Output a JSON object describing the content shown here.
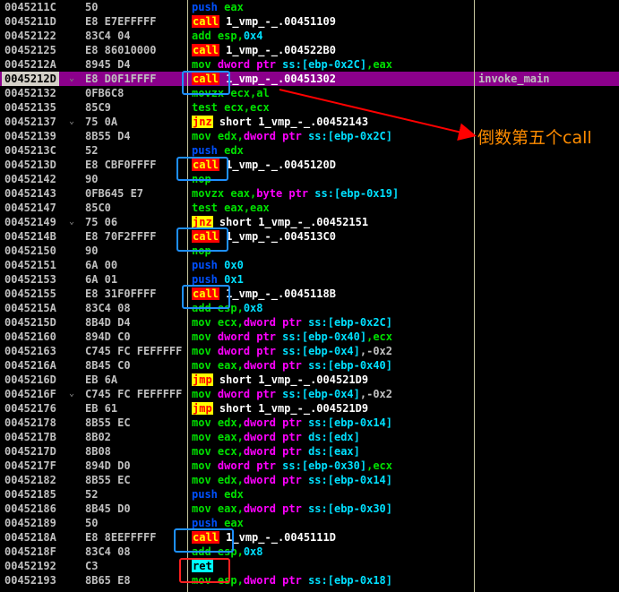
{
  "rows": [
    {
      "addr": "0045211C",
      "bytes": "50",
      "mn": "push",
      "mc": "m-push",
      "ops": [
        {
          "t": "eax",
          "c": "o-reg"
        }
      ]
    },
    {
      "addr": "0045211D",
      "bytes": "E8 E7EFFFFF",
      "mn": "call",
      "mc": "m-call",
      "ops": [
        {
          "t": "1_vmp_-_.00451109",
          "c": "o-default"
        }
      ]
    },
    {
      "addr": "00452122",
      "bytes": "83C4 04",
      "mn": "add",
      "mc": "m-add",
      "ops": [
        {
          "t": "esp,",
          "c": "o-reg"
        },
        {
          "t": "0x4",
          "c": "o-imm"
        }
      ]
    },
    {
      "addr": "00452125",
      "bytes": "E8 86010000",
      "mn": "call",
      "mc": "m-call",
      "ops": [
        {
          "t": "1_vmp_-_.004522B0",
          "c": "o-default"
        }
      ]
    },
    {
      "addr": "0045212A",
      "bytes": "8945 D4",
      "mn": "mov",
      "mc": "m-mov",
      "ops": [
        {
          "t": "dword ptr ss:[ebp-0x2C]",
          "c": "o-mem"
        },
        {
          "t": ",eax",
          "c": "o-reg"
        }
      ]
    },
    {
      "addr": "0045212D",
      "bytes": "E8 D0F1FFFF",
      "mn": "call",
      "mc": "m-call",
      "ops": [
        {
          "t": "1_vmp_-_.00451302",
          "c": "o-default"
        }
      ],
      "comment": "invoke_main",
      "selected": true,
      "bp": true
    },
    {
      "addr": "00452132",
      "bytes": "0FB6C8",
      "mn": "movzx",
      "mc": "m-movzx",
      "ops": [
        {
          "t": "ecx,al",
          "c": "o-reg"
        }
      ]
    },
    {
      "addr": "00452135",
      "bytes": "85C9",
      "mn": "test",
      "mc": "m-test",
      "ops": [
        {
          "t": "ecx,ecx",
          "c": "o-reg"
        }
      ]
    },
    {
      "addr": "00452137",
      "bytes": "75 0A",
      "mn": "jnz",
      "mc": "m-jcc",
      "ops": [
        {
          "t": "short 1_vmp_-_.00452143",
          "c": "o-default"
        }
      ],
      "bp": true
    },
    {
      "addr": "00452139",
      "bytes": "8B55 D4",
      "mn": "mov",
      "mc": "m-mov",
      "ops": [
        {
          "t": "edx,",
          "c": "o-reg"
        },
        {
          "t": "dword ptr ss:[ebp-0x2C]",
          "c": "o-mem"
        }
      ]
    },
    {
      "addr": "0045213C",
      "bytes": "52",
      "mn": "push",
      "mc": "m-push",
      "ops": [
        {
          "t": "edx",
          "c": "o-reg"
        }
      ]
    },
    {
      "addr": "0045213D",
      "bytes": "E8 CBF0FFFF",
      "mn": "call",
      "mc": "m-call",
      "ops": [
        {
          "t": "1_vmp_-_.0045120D",
          "c": "o-default"
        }
      ]
    },
    {
      "addr": "00452142",
      "bytes": "90",
      "mn": "nop",
      "mc": "m-nop",
      "ops": []
    },
    {
      "addr": "00452143",
      "bytes": "0FB645 E7",
      "mn": "movzx",
      "mc": "m-movzx",
      "ops": [
        {
          "t": "eax,",
          "c": "o-reg"
        },
        {
          "t": "byte ptr ss:[ebp-0x19]",
          "c": "o-mem"
        }
      ]
    },
    {
      "addr": "00452147",
      "bytes": "85C0",
      "mn": "test",
      "mc": "m-test",
      "ops": [
        {
          "t": "eax,eax",
          "c": "o-reg"
        }
      ]
    },
    {
      "addr": "00452149",
      "bytes": "75 06",
      "mn": "jnz",
      "mc": "m-jcc",
      "ops": [
        {
          "t": "short 1_vmp_-_.00452151",
          "c": "o-default"
        }
      ],
      "bp": true
    },
    {
      "addr": "0045214B",
      "bytes": "E8 70F2FFFF",
      "mn": "call",
      "mc": "m-call",
      "ops": [
        {
          "t": "1_vmp_-_.004513C0",
          "c": "o-default"
        }
      ]
    },
    {
      "addr": "00452150",
      "bytes": "90",
      "mn": "nop",
      "mc": "m-nop",
      "ops": []
    },
    {
      "addr": "00452151",
      "bytes": "6A 00",
      "mn": "push",
      "mc": "m-push",
      "ops": [
        {
          "t": "0x0",
          "c": "o-imm"
        }
      ]
    },
    {
      "addr": "00452153",
      "bytes": "6A 01",
      "mn": "push",
      "mc": "m-push",
      "ops": [
        {
          "t": "0x1",
          "c": "o-imm"
        }
      ]
    },
    {
      "addr": "00452155",
      "bytes": "E8 31F0FFFF",
      "mn": "call",
      "mc": "m-call",
      "ops": [
        {
          "t": "1_vmp_-_.0045118B",
          "c": "o-default"
        }
      ]
    },
    {
      "addr": "0045215A",
      "bytes": "83C4 08",
      "mn": "add",
      "mc": "m-add",
      "ops": [
        {
          "t": "esp,",
          "c": "o-reg"
        },
        {
          "t": "0x8",
          "c": "o-imm"
        }
      ]
    },
    {
      "addr": "0045215D",
      "bytes": "8B4D D4",
      "mn": "mov",
      "mc": "m-mov",
      "ops": [
        {
          "t": "ecx,",
          "c": "o-reg"
        },
        {
          "t": "dword ptr ss:[ebp-0x2C]",
          "c": "o-mem"
        }
      ]
    },
    {
      "addr": "00452160",
      "bytes": "894D C0",
      "mn": "mov",
      "mc": "m-mov",
      "ops": [
        {
          "t": "dword ptr ss:[ebp-0x40]",
          "c": "o-mem"
        },
        {
          "t": ",ecx",
          "c": "o-reg"
        }
      ]
    },
    {
      "addr": "00452163",
      "bytes": "C745 FC FEFFFFF",
      "mn": "mov",
      "mc": "m-mov",
      "ops": [
        {
          "t": "dword ptr ss:[ebp-0x4]",
          "c": "o-mem"
        },
        {
          "t": ",-0x2",
          "c": "neg"
        }
      ]
    },
    {
      "addr": "0045216A",
      "bytes": "8B45 C0",
      "mn": "mov",
      "mc": "m-mov",
      "ops": [
        {
          "t": "eax,",
          "c": "o-reg"
        },
        {
          "t": "dword ptr ss:[ebp-0x40]",
          "c": "o-mem"
        }
      ]
    },
    {
      "addr": "0045216D",
      "bytes": "EB 6A",
      "mn": "jmp",
      "mc": "m-jmp",
      "ops": [
        {
          "t": "short 1_vmp_-_.004521D9",
          "c": "o-default"
        }
      ]
    },
    {
      "addr": "0045216F",
      "bytes": "C745 FC FEFFFFF",
      "mn": "mov",
      "mc": "m-mov",
      "ops": [
        {
          "t": "dword ptr ss:[ebp-0x4]",
          "c": "o-mem"
        },
        {
          "t": ",-0x2",
          "c": "neg"
        }
      ],
      "bp": true
    },
    {
      "addr": "00452176",
      "bytes": "EB 61",
      "mn": "jmp",
      "mc": "m-jmp",
      "ops": [
        {
          "t": "short 1_vmp_-_.004521D9",
          "c": "o-default"
        }
      ]
    },
    {
      "addr": "00452178",
      "bytes": "8B55 EC",
      "mn": "mov",
      "mc": "m-mov",
      "ops": [
        {
          "t": "edx,",
          "c": "o-reg"
        },
        {
          "t": "dword ptr ss:[ebp-0x14]",
          "c": "o-mem"
        }
      ]
    },
    {
      "addr": "0045217B",
      "bytes": "8B02",
      "mn": "mov",
      "mc": "m-mov",
      "ops": [
        {
          "t": "eax,",
          "c": "o-reg"
        },
        {
          "t": "dword ptr ds:[edx]",
          "c": "o-memds"
        }
      ]
    },
    {
      "addr": "0045217D",
      "bytes": "8B08",
      "mn": "mov",
      "mc": "m-mov",
      "ops": [
        {
          "t": "ecx,",
          "c": "o-reg"
        },
        {
          "t": "dword ptr ds:[eax]",
          "c": "o-memds"
        }
      ]
    },
    {
      "addr": "0045217F",
      "bytes": "894D D0",
      "mn": "mov",
      "mc": "m-mov",
      "ops": [
        {
          "t": "dword ptr ss:[ebp-0x30]",
          "c": "o-mem"
        },
        {
          "t": ",ecx",
          "c": "o-reg"
        }
      ]
    },
    {
      "addr": "00452182",
      "bytes": "8B55 EC",
      "mn": "mov",
      "mc": "m-mov",
      "ops": [
        {
          "t": "edx,",
          "c": "o-reg"
        },
        {
          "t": "dword ptr ss:[ebp-0x14]",
          "c": "o-mem"
        }
      ]
    },
    {
      "addr": "00452185",
      "bytes": "52",
      "mn": "push",
      "mc": "m-push",
      "ops": [
        {
          "t": "edx",
          "c": "o-reg"
        }
      ]
    },
    {
      "addr": "00452186",
      "bytes": "8B45 D0",
      "mn": "mov",
      "mc": "m-mov",
      "ops": [
        {
          "t": "eax,",
          "c": "o-reg"
        },
        {
          "t": "dword ptr ss:[ebp-0x30]",
          "c": "o-mem"
        }
      ]
    },
    {
      "addr": "00452189",
      "bytes": "50",
      "mn": "push",
      "mc": "m-push",
      "ops": [
        {
          "t": "eax",
          "c": "o-reg"
        }
      ]
    },
    {
      "addr": "0045218A",
      "bytes": "E8 8EEFFFFF",
      "mn": "call",
      "mc": "m-call",
      "ops": [
        {
          "t": "1_vmp_-_.0045111D",
          "c": "o-default"
        }
      ]
    },
    {
      "addr": "0045218F",
      "bytes": "83C4 08",
      "mn": "add",
      "mc": "m-add",
      "ops": [
        {
          "t": "esp,",
          "c": "o-reg"
        },
        {
          "t": "0x8",
          "c": "o-imm"
        }
      ]
    },
    {
      "addr": "00452192",
      "bytes": "C3",
      "mn": "ret",
      "mc": "m-ret",
      "ops": []
    },
    {
      "addr": "00452193",
      "bytes": "8B65 E8",
      "mn": "mov",
      "mc": "m-mov",
      "ops": [
        {
          "t": "esp,",
          "c": "o-reg"
        },
        {
          "t": "dword ptr ss:[ebp-0x18]",
          "c": "o-mem"
        }
      ]
    }
  ],
  "annotation": {
    "text": "倒数第五个call"
  },
  "colors": {
    "highlight_box": "#1e90ff",
    "ret_box": "#ff2020",
    "arrow": "#ff0000",
    "annotation": "#ff8c00",
    "selected_row": "#8b008b"
  }
}
